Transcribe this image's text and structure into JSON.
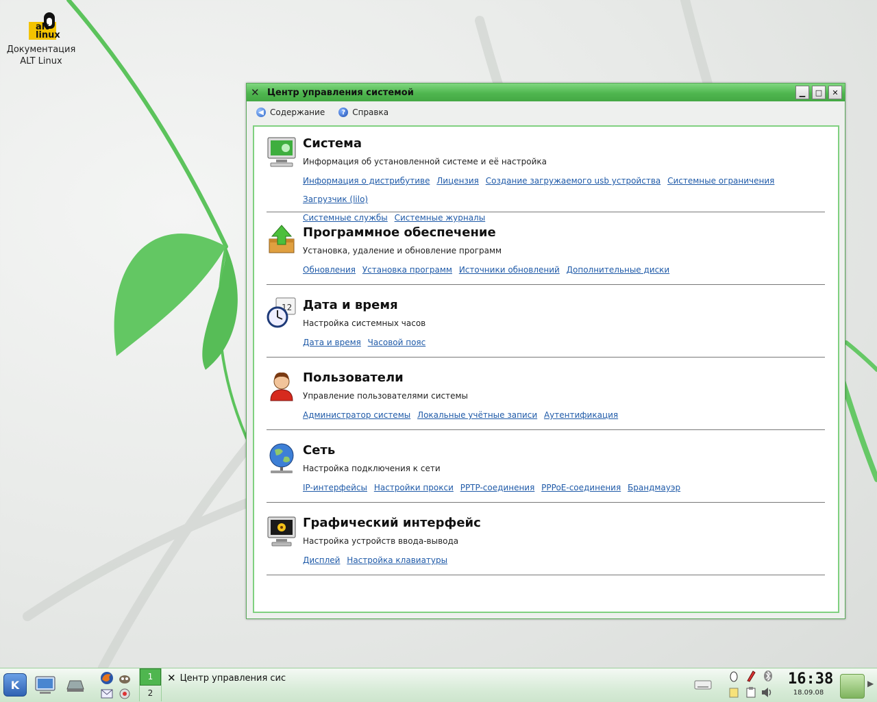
{
  "desktop": {
    "icon_label_line1": "Документация",
    "icon_label_line2": "ALT Linux",
    "logo_text_1": "alt",
    "logo_text_2": "linux"
  },
  "window": {
    "title": "Центр управления системой",
    "toolbar": {
      "contents_label": "Содержание",
      "help_label": "Справка"
    },
    "sections": [
      {
        "title": "Система",
        "description": "Информация об установленной системе и её настройка",
        "icon": "computer-monitor-icon",
        "links": [
          "Информация о дистрибутиве",
          "Лицензия",
          "Создание загружаемого usb устройства",
          "Системные ограничения",
          "Загрузчик (lilo)",
          "Системные службы",
          "Системные журналы"
        ]
      },
      {
        "title": "Программное обеспечение",
        "description": "Установка, удаление и обновление программ",
        "icon": "package-upgrade-icon",
        "links": [
          "Обновления",
          "Установка программ",
          "Источники обновлений",
          "Дополнительные диски"
        ]
      },
      {
        "title": "Дата и время",
        "description": "Настройка системных часов",
        "icon": "clock-calendar-icon",
        "links": [
          "Дата и время",
          "Часовой пояс"
        ]
      },
      {
        "title": "Пользователи",
        "description": "Управление пользователями системы",
        "icon": "user-icon",
        "links": [
          "Администратор системы",
          "Локальные учётные записи",
          "Аутентификация"
        ]
      },
      {
        "title": "Сеть",
        "description": "Настройка подключения к сети",
        "icon": "network-globe-icon",
        "links": [
          "IP-интерфейсы",
          "Настройки прокси",
          "PPTP-соединения",
          "PPPoE-соединения",
          "Брандмауэр"
        ]
      },
      {
        "title": "Графический интерфейс",
        "description": "Настройка устройств ввода-вывода",
        "icon": "display-icon",
        "links": [
          "Дисплей",
          "Настройка клавиатуры"
        ]
      }
    ]
  },
  "taskbar": {
    "kmenu_label": "K",
    "desktop1": "1",
    "desktop2": "2",
    "task_title": "Центр управления сис",
    "clock_time": "16:38",
    "clock_date": "18.09.08"
  },
  "colors": {
    "accent": "#4fb64f",
    "link": "#1f5aa8",
    "window_frame": "#5aa95a"
  }
}
